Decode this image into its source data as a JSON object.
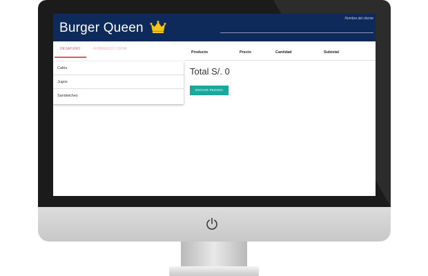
{
  "app": {
    "brand": "Burger Queen",
    "client_placeholder": "Nombre del cliente"
  },
  "tabs": [
    {
      "label": "DESAYUNO",
      "active": true
    },
    {
      "label": "ALMUERZO / CENA",
      "active": false
    }
  ],
  "menu": {
    "items": [
      {
        "label": "Cafés"
      },
      {
        "label": "Jugos"
      },
      {
        "label": "Sandwiches"
      }
    ]
  },
  "order": {
    "columns": [
      "Producto",
      "Precio",
      "Cantidad",
      "Subtotal"
    ],
    "total": "Total S/. 0",
    "send_label": "ENVIAR PEDIDO"
  },
  "icons": {
    "brand_icon": "crown-icon",
    "power_icon": "power-icon"
  },
  "colors": {
    "header": "#0e2a5b",
    "accent_tab": "#e8565a",
    "button": "#1aa79c",
    "crown": "#f5c518"
  }
}
